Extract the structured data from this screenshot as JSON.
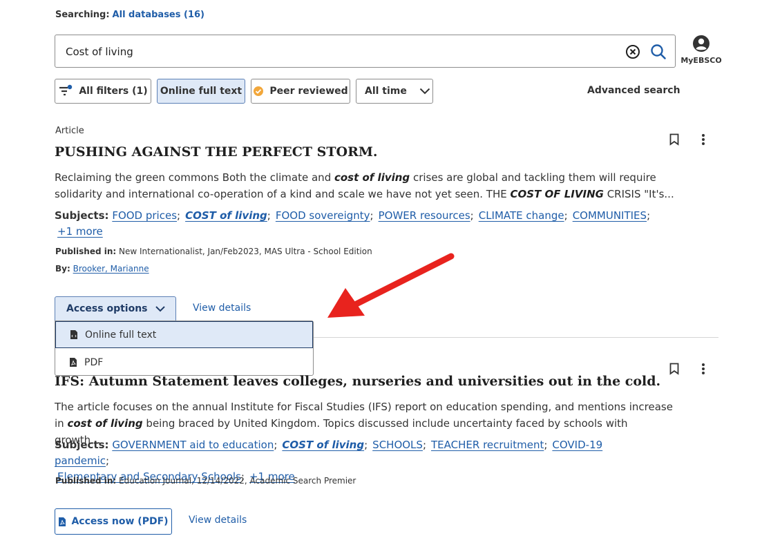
{
  "header": {
    "searching_label": "Searching:",
    "databases_link": "All databases (16)"
  },
  "search": {
    "value": "Cost of living",
    "myebsco_label": "MyEBSCO"
  },
  "filters": {
    "all_filters": "All filters (1)",
    "online_full_text": "Online full text",
    "peer_reviewed": "Peer reviewed",
    "all_time": "All time",
    "advanced_search": "Advanced search"
  },
  "results": [
    {
      "type": "Article",
      "title": "PUSHING AGAINST THE PERFECT STORM.",
      "abstract_line1_a": "Reclaiming the green commons Both the climate and ",
      "abstract_line1_em": "cost of living",
      "abstract_line1_b": " crises are global and tackling them will require",
      "abstract_line2_a": "solidarity and international co-operation of a kind and scale we have not yet seen. THE ",
      "abstract_line2_em": "COST OF LIVING",
      "abstract_line2_b": " CRISIS \"It's...",
      "subjects_label": "Subjects:",
      "subjects": [
        "FOOD prices",
        "COST of living",
        "FOOD sovereignty",
        "POWER resources",
        "CLIMATE change",
        "COMMUNITIES"
      ],
      "more": "+1 more",
      "published_label": "Published in:",
      "published": "New Internationalist, Jan/Feb2023, MAS Ultra - School Edition",
      "by_label": "By:",
      "author": "Brooker, Marianne",
      "access_options": "Access options",
      "view_details": "View details",
      "dropdown": {
        "online_full_text": "Online full text",
        "pdf": "PDF"
      }
    },
    {
      "title": "IFS: Autumn Statement leaves colleges, nurseries and universities out in the cold.",
      "abstract_line1": "The article focuses on the annual Institute for Fiscal Studies (IFS) report on education spending, and mentions increase",
      "abstract_line2_a": "in ",
      "abstract_line2_em": "cost of living",
      "abstract_line2_b": " being braced by United Kingdom. Topics discussed include uncertainty faced by schools with growth...",
      "subjects_label": "Subjects:",
      "subjects": [
        "GOVERNMENT aid to education",
        "COST of living",
        "SCHOOLS",
        "TEACHER recruitment",
        "COVID-19 pandemic",
        "Elementary and Secondary Schools"
      ],
      "more": "+1 more",
      "published_label": "Published in:",
      "published": "Education Journal, 12/14/2022, Academic Search Premier",
      "access_now": "Access now (PDF)",
      "view_details": "View details"
    }
  ],
  "colors": {
    "link": "#1f5da8",
    "chip_active_bg": "#dfe9f7",
    "annotation_arrow": "#e8231e",
    "peer_badge": "#f2a73b"
  }
}
